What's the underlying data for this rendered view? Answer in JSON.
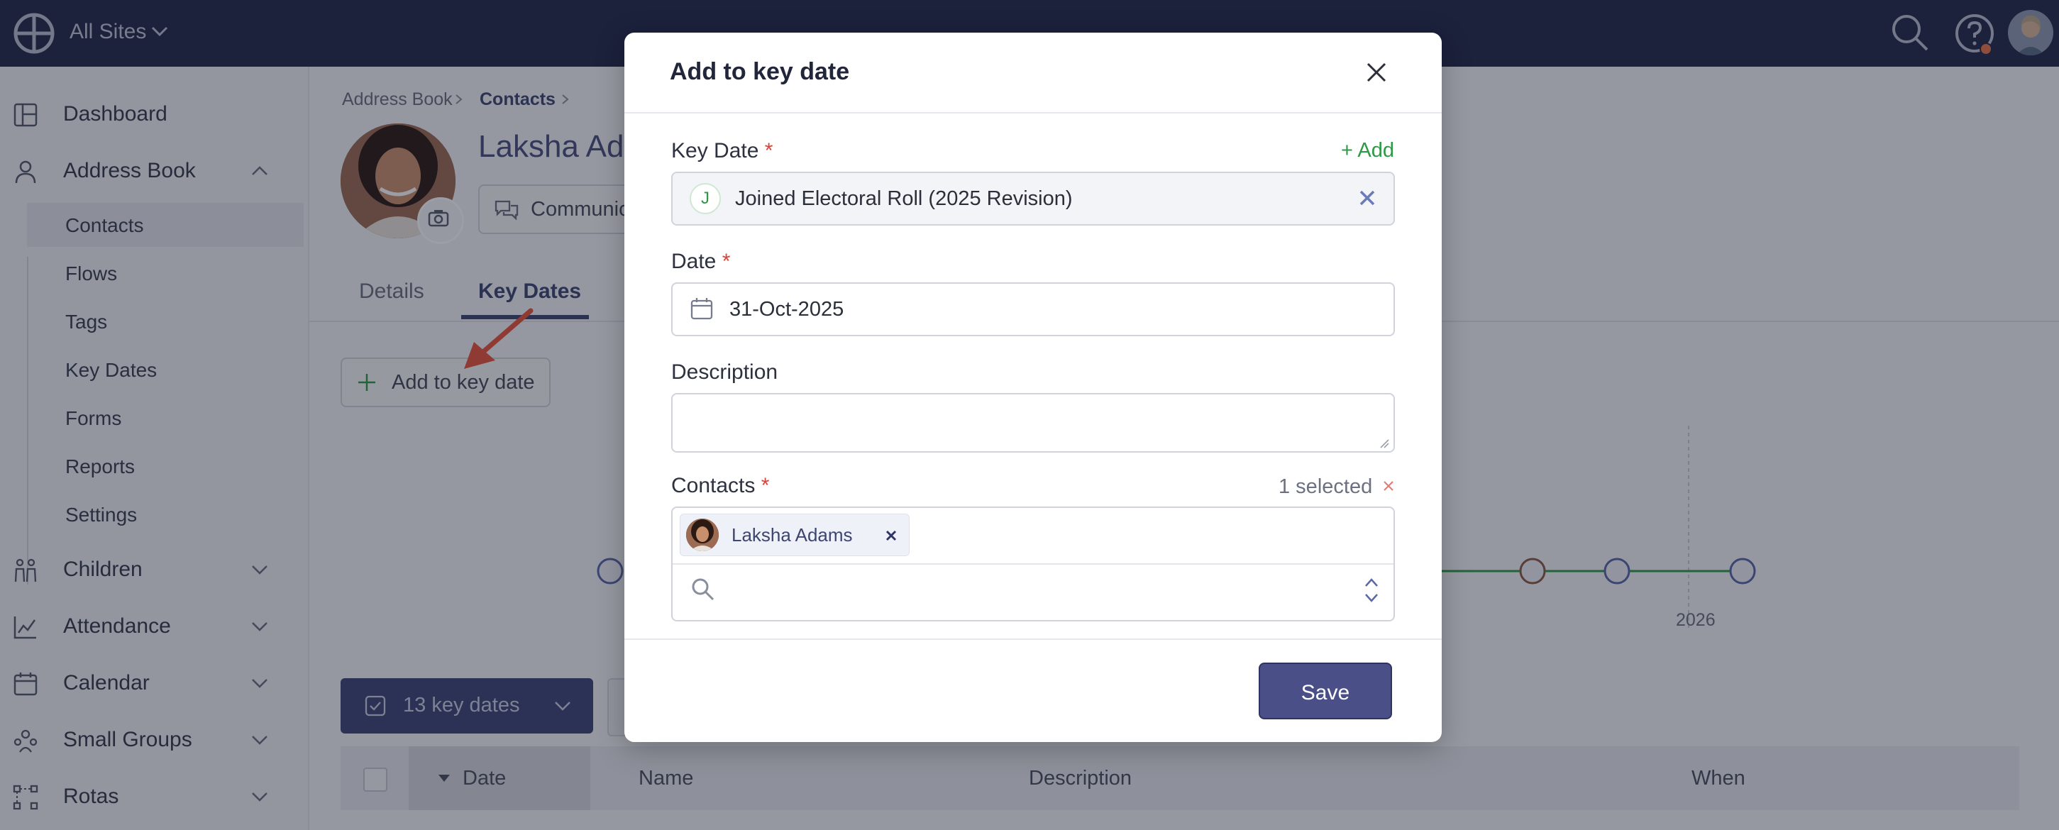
{
  "topbar": {
    "site_selector": "All Sites",
    "icons": [
      "globe-icon",
      "chevron-down-icon",
      "search-icon",
      "help-icon",
      "avatar"
    ]
  },
  "sidebar": {
    "items": [
      {
        "label": "Dashboard",
        "icon": "dashboard-icon"
      },
      {
        "label": "Address Book",
        "icon": "person-icon",
        "expanded": true
      },
      {
        "label": "Children",
        "icon": "children-icon"
      },
      {
        "label": "Attendance",
        "icon": "chart-icon"
      },
      {
        "label": "Calendar",
        "icon": "calendar-icon"
      },
      {
        "label": "Small Groups",
        "icon": "groups-icon"
      },
      {
        "label": "Rotas",
        "icon": "rota-icon"
      }
    ],
    "sub_items": [
      "Contacts",
      "Flows",
      "Tags",
      "Key Dates",
      "Forms",
      "Reports",
      "Settings"
    ],
    "active_sub": "Contacts"
  },
  "main": {
    "breadcrumb": [
      "Address Book",
      "Contacts"
    ],
    "profile_name": "Laksha Adams",
    "communicate_label": "Communicate",
    "tabs": [
      "Details",
      "Key Dates"
    ],
    "active_tab": "Key Dates",
    "add_key_date_label": "Add to key date",
    "timeline_year": "2026",
    "key_dates_button": "13 key dates",
    "table_headers": {
      "date": "Date",
      "name": "Name",
      "description": "Description",
      "when": "When"
    }
  },
  "modal": {
    "title": "Add to key date",
    "key_date_label": "Key Date",
    "add_link": "+ Add",
    "key_date_badge": "J",
    "key_date_value": "Joined Electoral Roll (2025 Revision)",
    "date_label": "Date",
    "date_value": "31-Oct-2025",
    "description_label": "Description",
    "description_value": "",
    "contacts_label": "Contacts",
    "selected_count": "1 selected",
    "contact_chip": "Laksha Adams",
    "search_placeholder": "",
    "save_label": "Save",
    "required_mark": "*"
  },
  "colors": {
    "topbar": "#23294a",
    "primary": "#4a5087",
    "accent_green": "#2e9a45",
    "required_red": "#d8443c",
    "annotation_arrow": "#e8553b"
  }
}
